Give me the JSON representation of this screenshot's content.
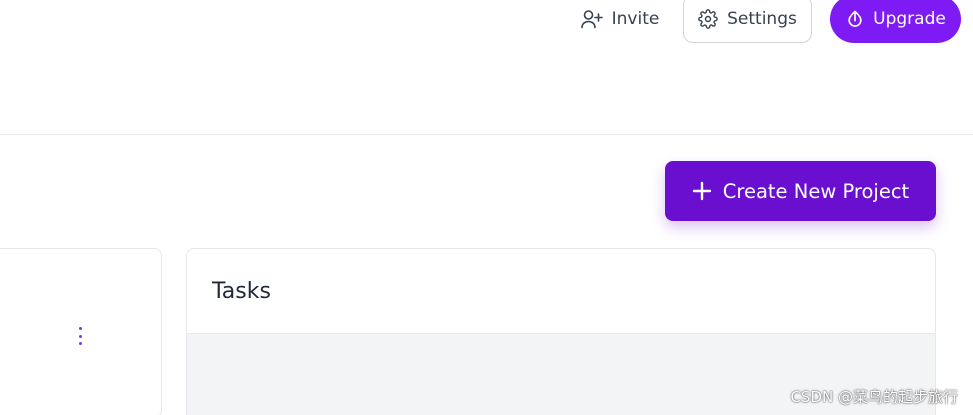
{
  "header": {
    "invite_label": "Invite",
    "settings_label": "Settings",
    "upgrade_label": "Upgrade"
  },
  "main": {
    "create_button_label": "Create New Project",
    "tasks_card_title": "Tasks"
  },
  "watermark": "CSDN @菜鸟的起步旅行",
  "colors": {
    "accent": "#7e1bf4",
    "create_button": "#6a0ed0",
    "border": "#e5e7eb",
    "card_body_bg": "#f3f4f6",
    "text": "#374151"
  },
  "icons": {
    "invite": "user-plus-icon",
    "settings": "gear-icon",
    "upgrade": "upload-circle-icon",
    "create": "plus-icon",
    "menu": "more-vertical-icon"
  }
}
